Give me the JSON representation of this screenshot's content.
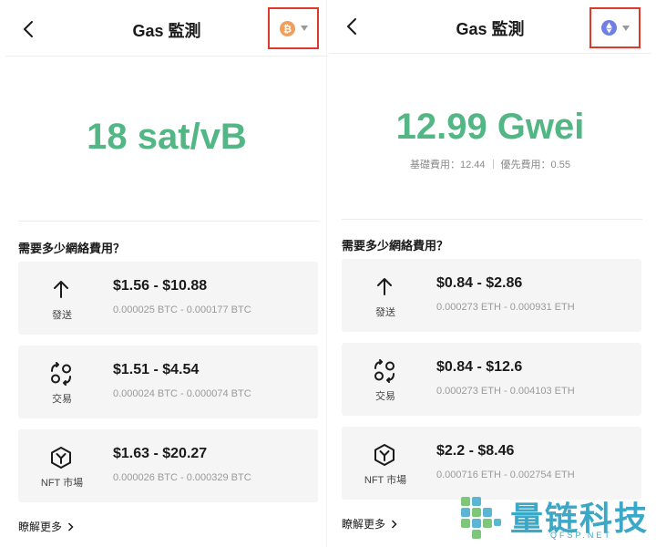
{
  "colors": {
    "accent_green": "#52b784",
    "highlight_red": "#e0392b",
    "btc_orange": "#f0a05a",
    "eth_blue": "#6e7fe6"
  },
  "left": {
    "title": "Gas 監測",
    "coin_icon": "bitcoin-icon",
    "fee": "18 sat/vB",
    "question": "需要多少網絡費用？",
    "cards": [
      {
        "icon": "arrow-up-icon",
        "label": "發送",
        "range": "$1.56 - $10.88",
        "crypto": "0.000025 BTC - 0.000177 BTC"
      },
      {
        "icon": "swap-icon",
        "label": "交易",
        "range": "$1.51 - $4.54",
        "crypto": "0.000024 BTC - 0.000074 BTC"
      },
      {
        "icon": "nft-hexagon-icon",
        "label": "NFT 市場",
        "range": "$1.63 - $20.27",
        "crypto": "0.000026 BTC - 0.000329 BTC"
      }
    ],
    "more": "瞭解更多"
  },
  "right": {
    "title": "Gas 監測",
    "coin_icon": "ethereum-icon",
    "fee": "12.99 Gwei",
    "base_fee": "基礎費用：12.44",
    "priority_fee": "優先費用：0.55",
    "question": "需要多少網絡費用？",
    "cards": [
      {
        "icon": "arrow-up-icon",
        "label": "發送",
        "range": "$0.84 - $2.86",
        "crypto": "0.000273 ETH - 0.000931 ETH"
      },
      {
        "icon": "swap-icon",
        "label": "交易",
        "range": "$0.84 - $12.6",
        "crypto": "0.000273 ETH - 0.004103 ETH"
      },
      {
        "icon": "nft-hexagon-icon",
        "label": "NFT 市場",
        "range": "$2.2 - $8.46",
        "crypto": "0.000716 ETH - 0.002754 ETH"
      }
    ],
    "more": "瞭解更多"
  },
  "watermark": {
    "text": "量链科技",
    "url": "QFSP.NET"
  }
}
